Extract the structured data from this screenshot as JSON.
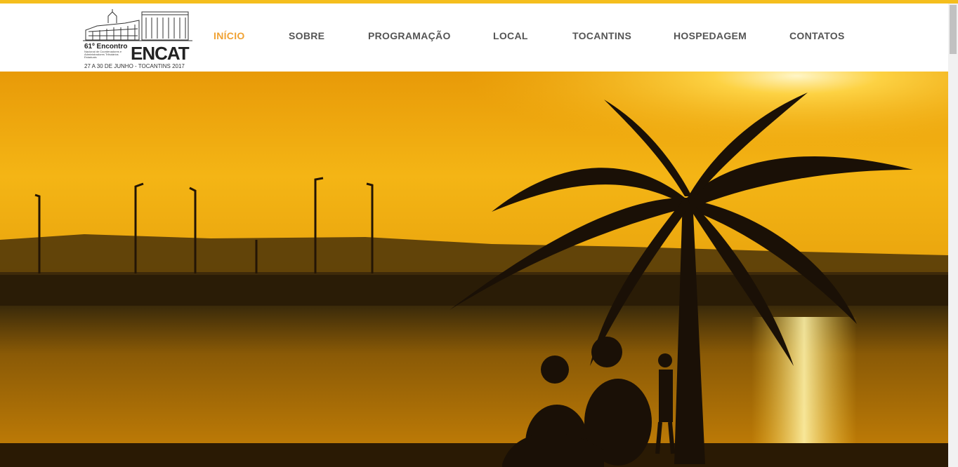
{
  "logo": {
    "line1": "61º Encontro",
    "subtitle": "Nacional de Coordenadores e Administradores Tributários Estaduais",
    "brand": "ENCAT",
    "dates": "27 A 30 DE JUNHO - TOCANTINS 2017"
  },
  "nav": {
    "items": [
      {
        "label": "INÍCIO",
        "active": true
      },
      {
        "label": "SOBRE"
      },
      {
        "label": "PROGRAMAÇÃO"
      },
      {
        "label": "LOCAL"
      },
      {
        "label": "TOCANTINS"
      },
      {
        "label": "HOSPEDAGEM"
      },
      {
        "label": "CONTATOS"
      }
    ]
  },
  "colors": {
    "accent": "#f0a233",
    "topbar": "#f5be1d",
    "nav_text": "#555555"
  },
  "hero": {
    "icon": "sunset-palm-beach-photo"
  }
}
